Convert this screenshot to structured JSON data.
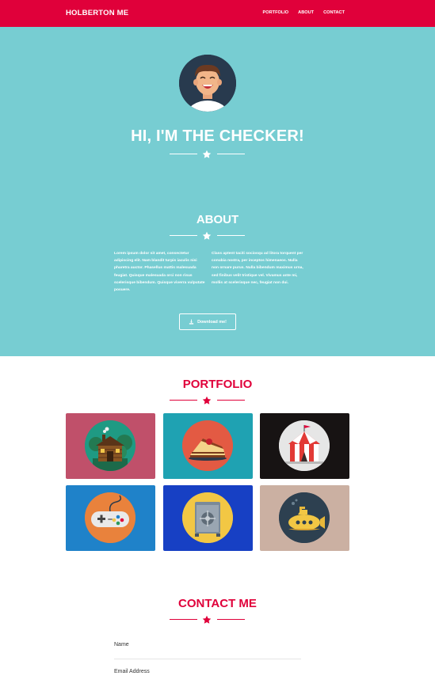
{
  "navbar": {
    "brand": "HOLBERTON ME",
    "links": [
      "PORTFOLIO",
      "ABOUT",
      "CONTACT"
    ]
  },
  "hero": {
    "title": "HI, I'M THE CHECKER!"
  },
  "about": {
    "title": "ABOUT",
    "left_text": "Lorem ipsum dolor sit amet, consectetur adipiscing elit. Nam blandit turpis iaculis nisi pharetra auctor. Phasellus mattis malesuada feugiat. Quisque malesuada orci non risus scelerisque bibendum. Quisque viverra vulputate posuere.",
    "right_text": "Class aptent taciti sociosqu ad litora torquent per conubia nostra, per inceptos himenaeos. Nulla non ornare purus. Nulla bibendum maximus urna, sed finibus velit tristique vel. Vivamus ante mi, mollis at scelerisque nec, feugiat non dui.",
    "download_label": "Download me!"
  },
  "portfolio": {
    "title": "PORTFOLIO",
    "tiles": [
      {
        "icon": "cabin-icon",
        "bg": "#c0506a"
      },
      {
        "icon": "cake-icon",
        "bg": "#1fa2b2"
      },
      {
        "icon": "circus-tent-icon",
        "bg": "#171313"
      },
      {
        "icon": "game-controller-icon",
        "bg": "#1f82c9"
      },
      {
        "icon": "safe-icon",
        "bg": "#1740c4"
      },
      {
        "icon": "submarine-icon",
        "bg": "#cbb0a2"
      }
    ]
  },
  "contact": {
    "title": "CONTACT ME",
    "fields": [
      "Name",
      "Email Address"
    ]
  },
  "colors": {
    "accent": "#e0003a",
    "hero_bg": "#77cdd2"
  }
}
